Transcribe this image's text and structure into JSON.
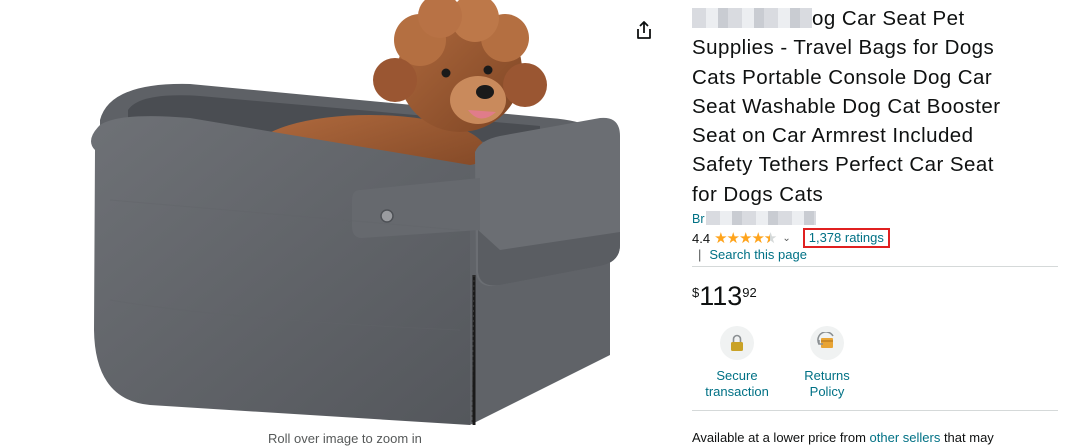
{
  "product": {
    "title_part1": "og Car Seat Pet",
    "title_lines": [
      "Supplies - Travel Bags for Dogs",
      "Cats Portable Console Dog Car",
      "Seat Washable Dog Cat Booster",
      "Seat on Car Armrest Included",
      "Safety Tethers Perfect Car Seat",
      "for Dogs Cats"
    ],
    "store_prefix": "Br",
    "rating_value": "4.4",
    "rating_stars": 4.4,
    "ratings_link": "1,378 ratings",
    "search_link": "Search this page",
    "price_symbol": "$",
    "price_whole": "113",
    "price_fraction": "92"
  },
  "features": [
    {
      "icon": "lock-icon",
      "line1": "Secure",
      "line2": "transaction"
    },
    {
      "icon": "returns-icon",
      "line1": "Returns",
      "line2": "Policy"
    }
  ],
  "image": {
    "zoom_hint": "Roll over image to zoom in",
    "share_icon": "share-icon"
  },
  "bottom": {
    "text_before": "Available at a lower price from ",
    "link": "other sellers",
    "text_after": " that may"
  },
  "colors": {
    "link": "#007185",
    "star": "#ffa41c",
    "highlight_box": "#e02020"
  }
}
